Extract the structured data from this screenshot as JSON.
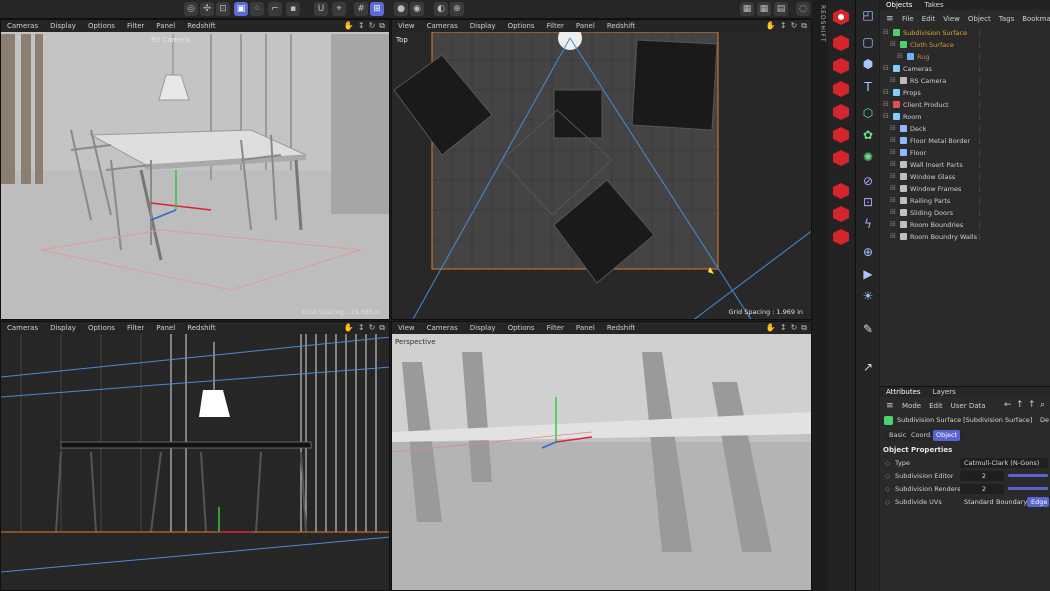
{
  "viewports": [
    {
      "id": "vp1",
      "menu": [
        "Cameras",
        "Display",
        "Options",
        "Filter",
        "Panel",
        "Redshift"
      ],
      "camera_label": "RS Camera",
      "grid": "Grid Spacing : 19.685 in"
    },
    {
      "id": "vp2",
      "menu": [
        "View",
        "Cameras",
        "Display",
        "Options",
        "Filter",
        "Panel",
        "Redshift"
      ],
      "view_label": "Top",
      "grid": "Grid Spacing : 1.969 in"
    },
    {
      "id": "vp3",
      "menu": [
        "Cameras",
        "Display",
        "Options",
        "Filter",
        "Panel",
        "Redshift"
      ]
    },
    {
      "id": "vp4",
      "menu": [
        "View",
        "Cameras",
        "Display",
        "Options",
        "Filter",
        "Panel",
        "Redshift"
      ],
      "view_label": "Perspective"
    }
  ],
  "redshift_label": "REDSHIFT",
  "objects_panel": {
    "tabs": [
      "Objects",
      "Takes"
    ],
    "menu": [
      "File",
      "Edit",
      "View",
      "Object",
      "Tags",
      "Bookmarks"
    ],
    "tree": [
      {
        "label": "Subdivision Surface",
        "indent": 0,
        "color": "#e0a53a",
        "icon": "#4bd36b"
      },
      {
        "label": "Cloth Surface",
        "indent": 1,
        "color": "#d69b3a",
        "icon": "#4bd36b"
      },
      {
        "label": "Rug",
        "indent": 2,
        "color": "#c08a3a",
        "icon": "#6fb0ff"
      },
      {
        "label": "Cameras",
        "indent": 0,
        "color": "#cfcfcf",
        "icon": "#7ad0ff"
      },
      {
        "label": "RS Camera",
        "indent": 1,
        "color": "#cfcfcf",
        "icon": "#bcbcbc"
      },
      {
        "label": "Props",
        "indent": 0,
        "color": "#cfcfcf",
        "icon": "#7ad0ff"
      },
      {
        "label": "Client Product",
        "indent": 0,
        "color": "#cfcfcf",
        "icon": "#e05050"
      },
      {
        "label": "Room",
        "indent": 0,
        "color": "#cfcfcf",
        "icon": "#7ad0ff"
      },
      {
        "label": "Deck",
        "indent": 1,
        "color": "#cfcfcf",
        "icon": "#8fb8ff"
      },
      {
        "label": "Floor Metal Border",
        "indent": 1,
        "color": "#cfcfcf",
        "icon": "#8fb8ff"
      },
      {
        "label": "Floor",
        "indent": 1,
        "color": "#cfcfcf",
        "icon": "#8fb8ff"
      },
      {
        "label": "Wall Insert Parts",
        "indent": 1,
        "color": "#cfcfcf",
        "icon": "#bfbfbf"
      },
      {
        "label": "Window Glass",
        "indent": 1,
        "color": "#cfcfcf",
        "icon": "#bfbfbf"
      },
      {
        "label": "Window Frames",
        "indent": 1,
        "color": "#cfcfcf",
        "icon": "#bfbfbf"
      },
      {
        "label": "Railing Parts",
        "indent": 1,
        "color": "#cfcfcf",
        "icon": "#bfbfbf"
      },
      {
        "label": "Sliding Doors",
        "indent": 1,
        "color": "#cfcfcf",
        "icon": "#bfbfbf"
      },
      {
        "label": "Room Boundries",
        "indent": 1,
        "color": "#cfcfcf",
        "icon": "#bfbfbf"
      },
      {
        "label": "Room Boundry Walls",
        "indent": 1,
        "color": "#cfcfcf",
        "icon": "#bfbfbf"
      }
    ]
  },
  "attributes": {
    "tabs": [
      "Attributes",
      "Layers"
    ],
    "menu": [
      "Mode",
      "Edit",
      "User Data"
    ],
    "object_title": "Subdivision Surface [Subdivision Surface]",
    "default_label": "De",
    "subtabs": [
      "Basic",
      "Coord.",
      "Object"
    ],
    "section": "Object Properties",
    "type_label": "Type",
    "type_value": "Catmull-Clark (N-Gons)",
    "editor_label": "Subdivision Editor",
    "editor_value": "2",
    "renderer_label": "Subdivision Renderer",
    "renderer_value": "2",
    "uvs_label": "Subdivide UVs",
    "uvs_options": [
      "Standard",
      "Boundary",
      "Edge"
    ]
  }
}
